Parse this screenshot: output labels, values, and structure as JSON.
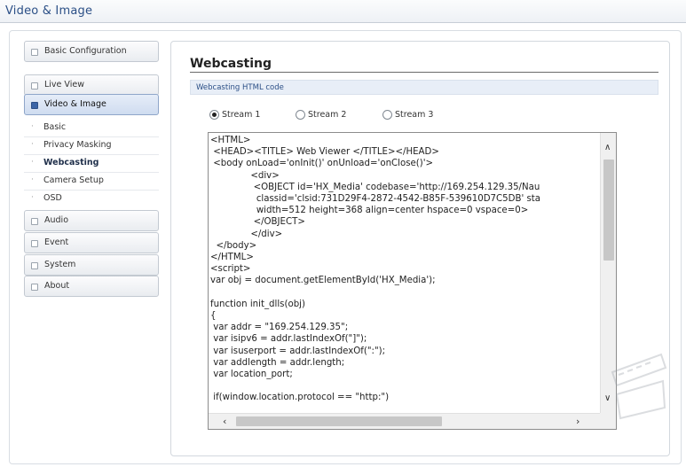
{
  "header": {
    "title": "Video & Image"
  },
  "sidebar": {
    "top_items": [
      {
        "label": "Basic Configuration"
      },
      {
        "label": "Live View"
      },
      {
        "label": "Video & Image"
      }
    ],
    "sub_items": [
      {
        "label": "Basic"
      },
      {
        "label": "Privacy Masking"
      },
      {
        "label": "Webcasting"
      },
      {
        "label": "Camera Setup"
      },
      {
        "label": "OSD"
      }
    ],
    "bottom_items": [
      {
        "label": "Audio"
      },
      {
        "label": "Event"
      },
      {
        "label": "System"
      },
      {
        "label": "About"
      }
    ],
    "active_item": "Video & Image",
    "active_sub_item": "Webcasting"
  },
  "main": {
    "title": "Webcasting",
    "section_header": "Webcasting HTML code",
    "streams": [
      {
        "label": "Stream 1",
        "checked": true
      },
      {
        "label": "Stream 2",
        "checked": false
      },
      {
        "label": "Stream 3",
        "checked": false
      }
    ],
    "code_text": "<HTML>\n <HEAD><TITLE> Web Viewer </TITLE></HEAD>\n <body onLoad='onInit()' onUnload='onClose()'>\n              <div>\n               <OBJECT id='HX_Media' codebase='http://169.254.129.35/Nau\n                classid='clsid:731D29F4-2872-4542-B85F-539610D7C5DB' sta\n                width=512 height=368 align=center hspace=0 vspace=0>\n               </OBJECT>\n              </div>\n  </body>\n</HTML>\n<script>\nvar obj = document.getElementById('HX_Media');\n\nfunction init_dlls(obj)\n{\n var addr = \"169.254.129.35\";\n var isipv6 = addr.lastIndexOf(\"]\");\n var isuserport = addr.lastIndexOf(\":\");\n var addlength = addr.length;\n var location_port;\n\n if(window.location.protocol == \"http:\")"
  },
  "icons": {
    "scroll_up": "scroll-up-arrow-icon",
    "scroll_down": "scroll-down-arrow-icon",
    "scroll_left": "scroll-left-arrow-icon",
    "scroll_right": "scroll-right-arrow-icon"
  },
  "colors": {
    "accent": "#2b4f86",
    "active_nav_bg": "#cfdcf0",
    "section_header_bg": "#e8eef7"
  }
}
